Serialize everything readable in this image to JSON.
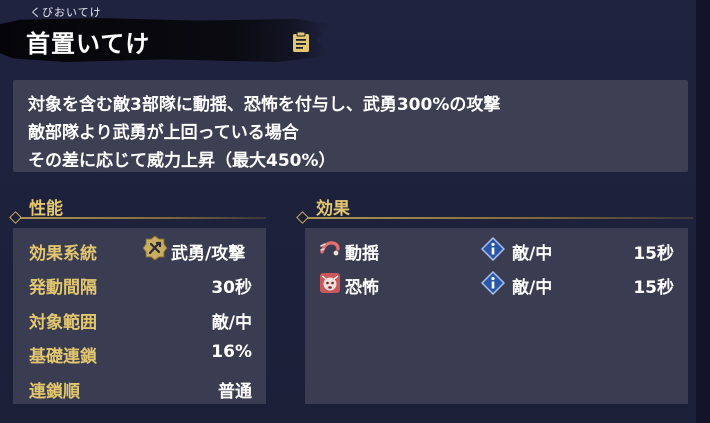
{
  "skill": {
    "furigana": "くびおいてけ",
    "name": "首置いてけ",
    "description": [
      "対象を含む敵3部隊に動揺、恐怖を付与し、武勇300%の攻撃",
      "敵部隊より武勇が上回っている場合",
      "その差に応じて威力上昇（最大450%）"
    ]
  },
  "performance": {
    "title": "性能",
    "rows": [
      {
        "label": "効果系統",
        "value": "武勇/攻撃",
        "icon": "martial-attack-icon"
      },
      {
        "label": "発動間隔",
        "value": "30秒"
      },
      {
        "label": "対象範囲",
        "value": "敵/中"
      },
      {
        "label": "基礎連鎖",
        "value": "16%"
      },
      {
        "label": "連鎖順",
        "value": "普通"
      }
    ]
  },
  "effects": {
    "title": "効果",
    "rows": [
      {
        "name": "動揺",
        "target": "敵/中",
        "duration": "15秒",
        "icon": "shaken-icon"
      },
      {
        "name": "恐怖",
        "target": "敵/中",
        "duration": "15秒",
        "icon": "fear-icon"
      }
    ]
  },
  "colors": {
    "accent_gold": "#e3c76e",
    "panel": "#3a3c51",
    "background": "#1b1f38",
    "effect_red": "#c8585a",
    "info_blue": "#2b58a6"
  }
}
